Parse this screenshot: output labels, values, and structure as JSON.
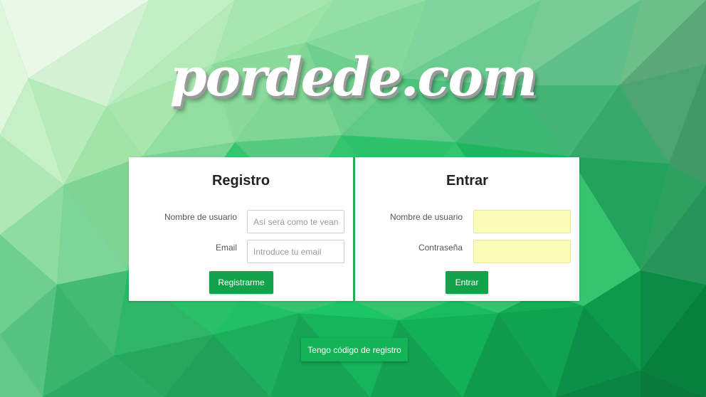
{
  "brand": {
    "logo_text": "pordede.com"
  },
  "register": {
    "title": "Registro",
    "username_label": "Nombre de usuario",
    "username_placeholder": "Así será como te vean los usuarios",
    "email_label": "Email",
    "email_placeholder": "Introduce tu email",
    "submit_label": "Registrarme"
  },
  "login": {
    "title": "Entrar",
    "username_label": "Nombre de usuario",
    "username_value": "",
    "password_label": "Contraseña",
    "password_value": "",
    "submit_label": "Entrar"
  },
  "footer": {
    "code_button_label": "Tengo código de registro"
  },
  "colors": {
    "primary_button": "#12a34a",
    "autofill_background": "#fbfdb8",
    "divider": "#26b35a"
  }
}
